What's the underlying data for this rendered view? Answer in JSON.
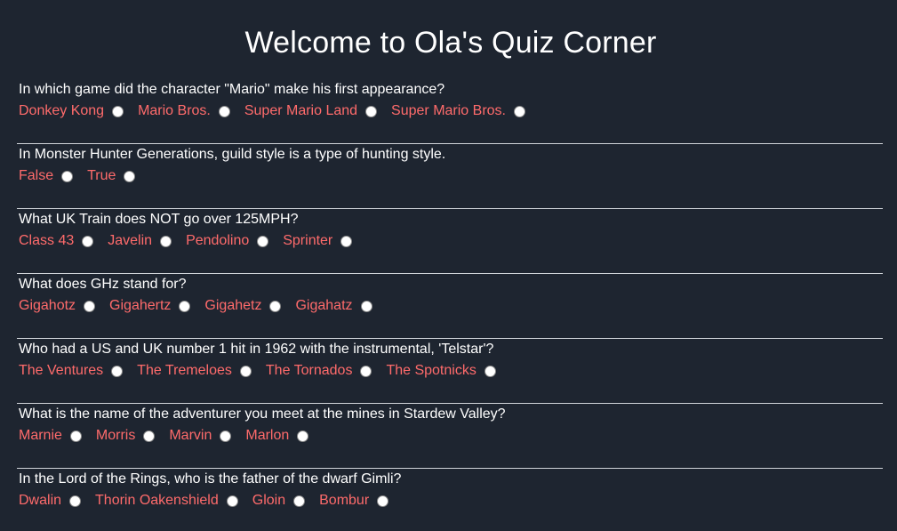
{
  "header": {
    "title": "Welcome to Ola's Quiz Corner"
  },
  "questions": [
    {
      "text": "In which game did the character \"Mario\" make his first appearance?",
      "options": [
        "Donkey Kong",
        "Mario Bros.",
        "Super Mario Land",
        "Super Mario Bros."
      ]
    },
    {
      "text": "In Monster Hunter Generations, guild style is a type of hunting style.",
      "options": [
        "False",
        "True"
      ]
    },
    {
      "text": "What UK Train does NOT go over 125MPH?",
      "options": [
        "Class 43",
        "Javelin",
        "Pendolino",
        "Sprinter"
      ]
    },
    {
      "text": "What does GHz stand for?",
      "options": [
        "Gigahotz",
        "Gigahertz",
        "Gigahetz",
        "Gigahatz"
      ]
    },
    {
      "text": "Who had a US and UK number 1 hit in 1962 with the instrumental, 'Telstar'?",
      "options": [
        "The Ventures",
        "The Tremeloes",
        "The Tornados",
        "The Spotnicks"
      ]
    },
    {
      "text": "What is the name of the adventurer you meet at the mines in Stardew Valley?",
      "options": [
        "Marnie",
        "Morris",
        "Marvin",
        "Marlon"
      ]
    },
    {
      "text": "In the Lord of the Rings, who is the father of the dwarf Gimli?",
      "options": [
        "Dwalin",
        "Thorin Oakenshield",
        "Gloin",
        "Bombur"
      ]
    }
  ],
  "colors": {
    "background": "#1e2530",
    "answer_text": "#ff6b6b",
    "question_text": "#ffffff",
    "divider": "#d0d4d9"
  }
}
